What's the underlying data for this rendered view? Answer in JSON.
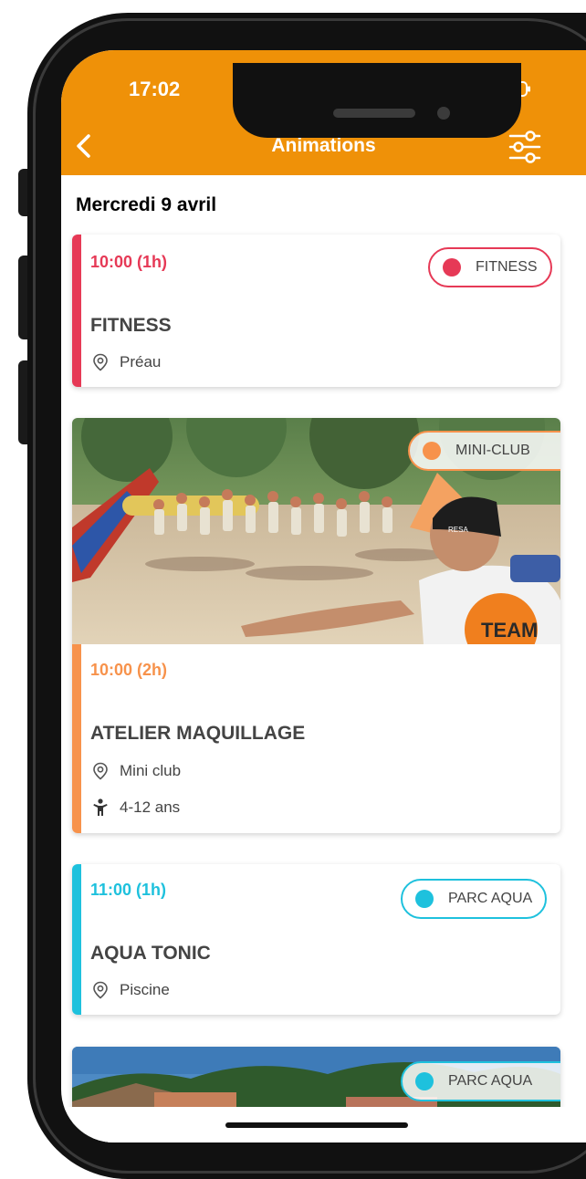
{
  "status_bar": {
    "time": "17:02"
  },
  "header": {
    "title": "Animations"
  },
  "date_heading": "Mercredi 9 avril",
  "events": [
    {
      "time": "10:00 (1h)",
      "title": "FITNESS",
      "location": "Préau",
      "category": "FITNESS",
      "color": "#e63956"
    },
    {
      "time": "10:00 (2h)",
      "title": "ATELIER MAQUILLAGE",
      "location": "Mini club",
      "age": "4-12 ans",
      "category": "MINI-CLUB",
      "color": "#f7924b"
    },
    {
      "time": "11:00 (1h)",
      "title": "AQUA TONIC",
      "location": "Piscine",
      "category": "PARC AQUA",
      "color": "#1ec1dd"
    },
    {
      "category": "PARC AQUA",
      "color": "#1ec1dd"
    }
  ],
  "colors": {
    "brand": "#ef9108"
  },
  "icons": [
    "back-icon",
    "filter-icon",
    "location-pin-icon",
    "child-icon",
    "signal-icon",
    "wifi-icon",
    "battery-icon"
  ]
}
